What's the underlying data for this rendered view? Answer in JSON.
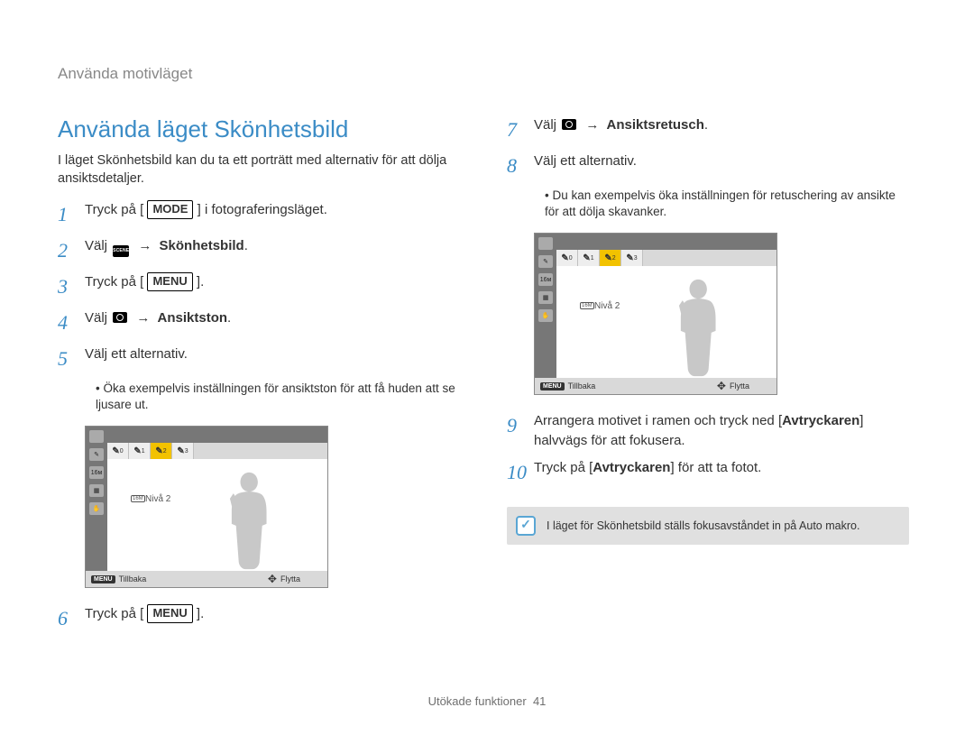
{
  "header": "Använda motivläget",
  "page_title": "Använda läget Skönhetsbild",
  "intro": "I läget Skönhetsbild kan du ta ett porträtt med alternativ för att dölja ansiktsdetaljer.",
  "labels": {
    "mode": "MODE",
    "menu": "MENU",
    "arrow": "→"
  },
  "steps_left": {
    "s1_a": "Tryck på [",
    "s1_b": "] i fotograferingsläget.",
    "s2_a": "Välj ",
    "s2_b": "Skönhetsbild",
    "s3_a": "Tryck på [",
    "s3_b": "].",
    "s4_a": "Välj ",
    "s4_b": "Ansiktston",
    "s5": "Välj ett alternativ.",
    "s5_sub": "Öka exempelvis inställningen för ansiktston för att få huden att se ljusare ut.",
    "s6_a": "Tryck på [",
    "s6_b": "]."
  },
  "steps_right": {
    "s7_a": "Välj ",
    "s7_b": "Ansiktsretusch",
    "s8": "Välj ett alternativ.",
    "s8_sub": "Du kan exempelvis öka inställningen för retuschering av ansikte för att dölja skavanker.",
    "s9_a": "Arrangera motivet i ramen och tryck ned [",
    "s9_b": "Avtryckaren",
    "s9_c": "] halvvägs för att fokusera.",
    "s10_a": "Tryck på [",
    "s10_b": "Avtryckaren",
    "s10_c": "] för att ta fotot."
  },
  "lcd": {
    "row_levels": [
      "0",
      "1",
      "2",
      "3"
    ],
    "selected_index": 2,
    "level_label": "Nivå 2",
    "footer_back_key": "MENU",
    "footer_back": "Tillbaka",
    "footer_move": "Flytta"
  },
  "note": "I läget för Skönhetsbild ställs fokusavståndet in på Auto makro.",
  "footer": {
    "section": "Utökade funktioner",
    "page": "41"
  },
  "colors": {
    "accent": "#3b8cc6",
    "note_bg": "#e0e0e0"
  }
}
